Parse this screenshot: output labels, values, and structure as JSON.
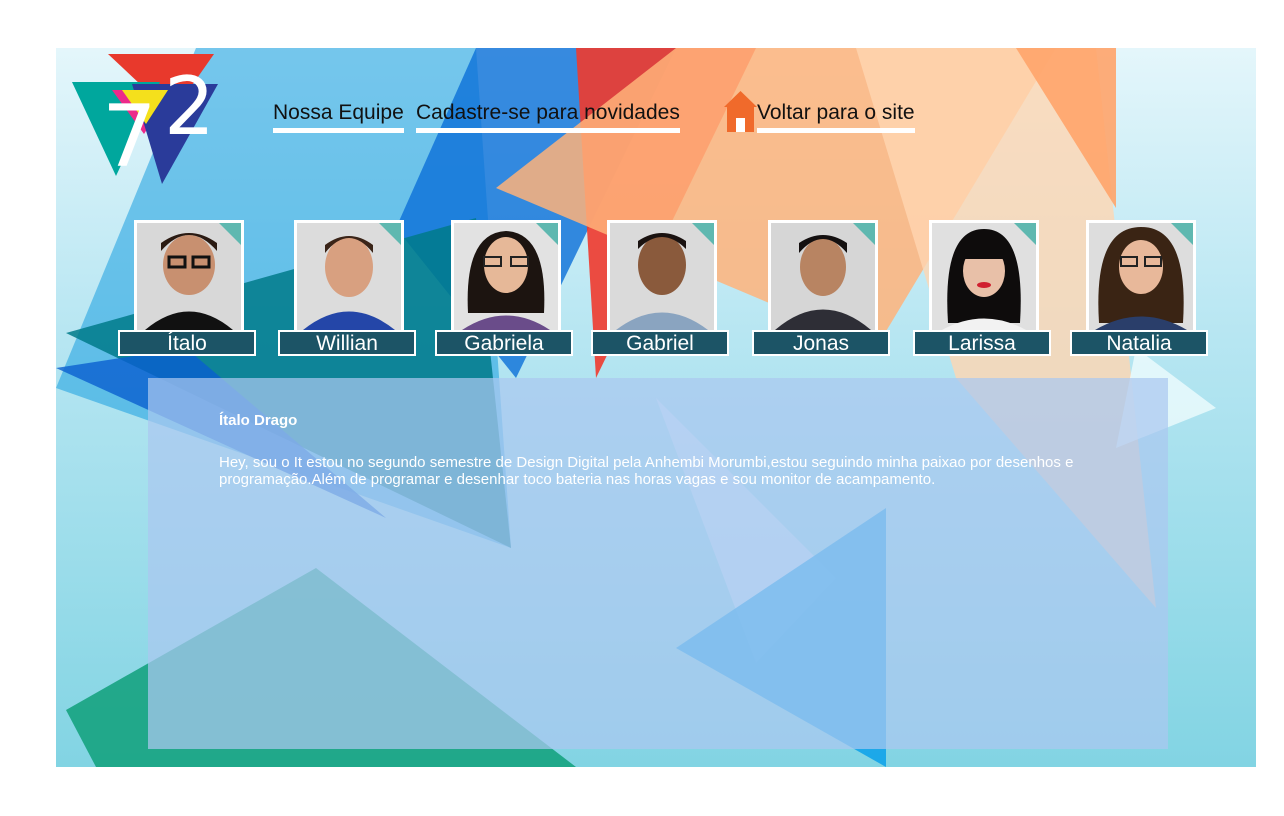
{
  "nav": {
    "team_label": "Nossa Equipe",
    "signup_label": "Cadastre-se para novidades",
    "back_label": "Voltar para o site"
  },
  "members": [
    {
      "name": "Ítalo"
    },
    {
      "name": "Willian"
    },
    {
      "name": "Gabriela"
    },
    {
      "name": "Gabriel"
    },
    {
      "name": "Jonas"
    },
    {
      "name": "Larissa"
    },
    {
      "name": "Natalia"
    }
  ],
  "profile": {
    "title": "Ítalo Drago",
    "description": "Hey, sou o It estou no segundo semestre de Design Digital pela Anhembi Morumbi,estou seguindo minha paixao por desenhos e programação.Além de programar e desenhar toco bateria nas horas vagas e sou monitor de acampamento."
  },
  "colors": {
    "name_tag": "#1c5466",
    "home_icon": "#f06a2b",
    "panel": "#aac8f0"
  },
  "icons": {
    "home": "home-icon",
    "logo": "logo-72"
  }
}
